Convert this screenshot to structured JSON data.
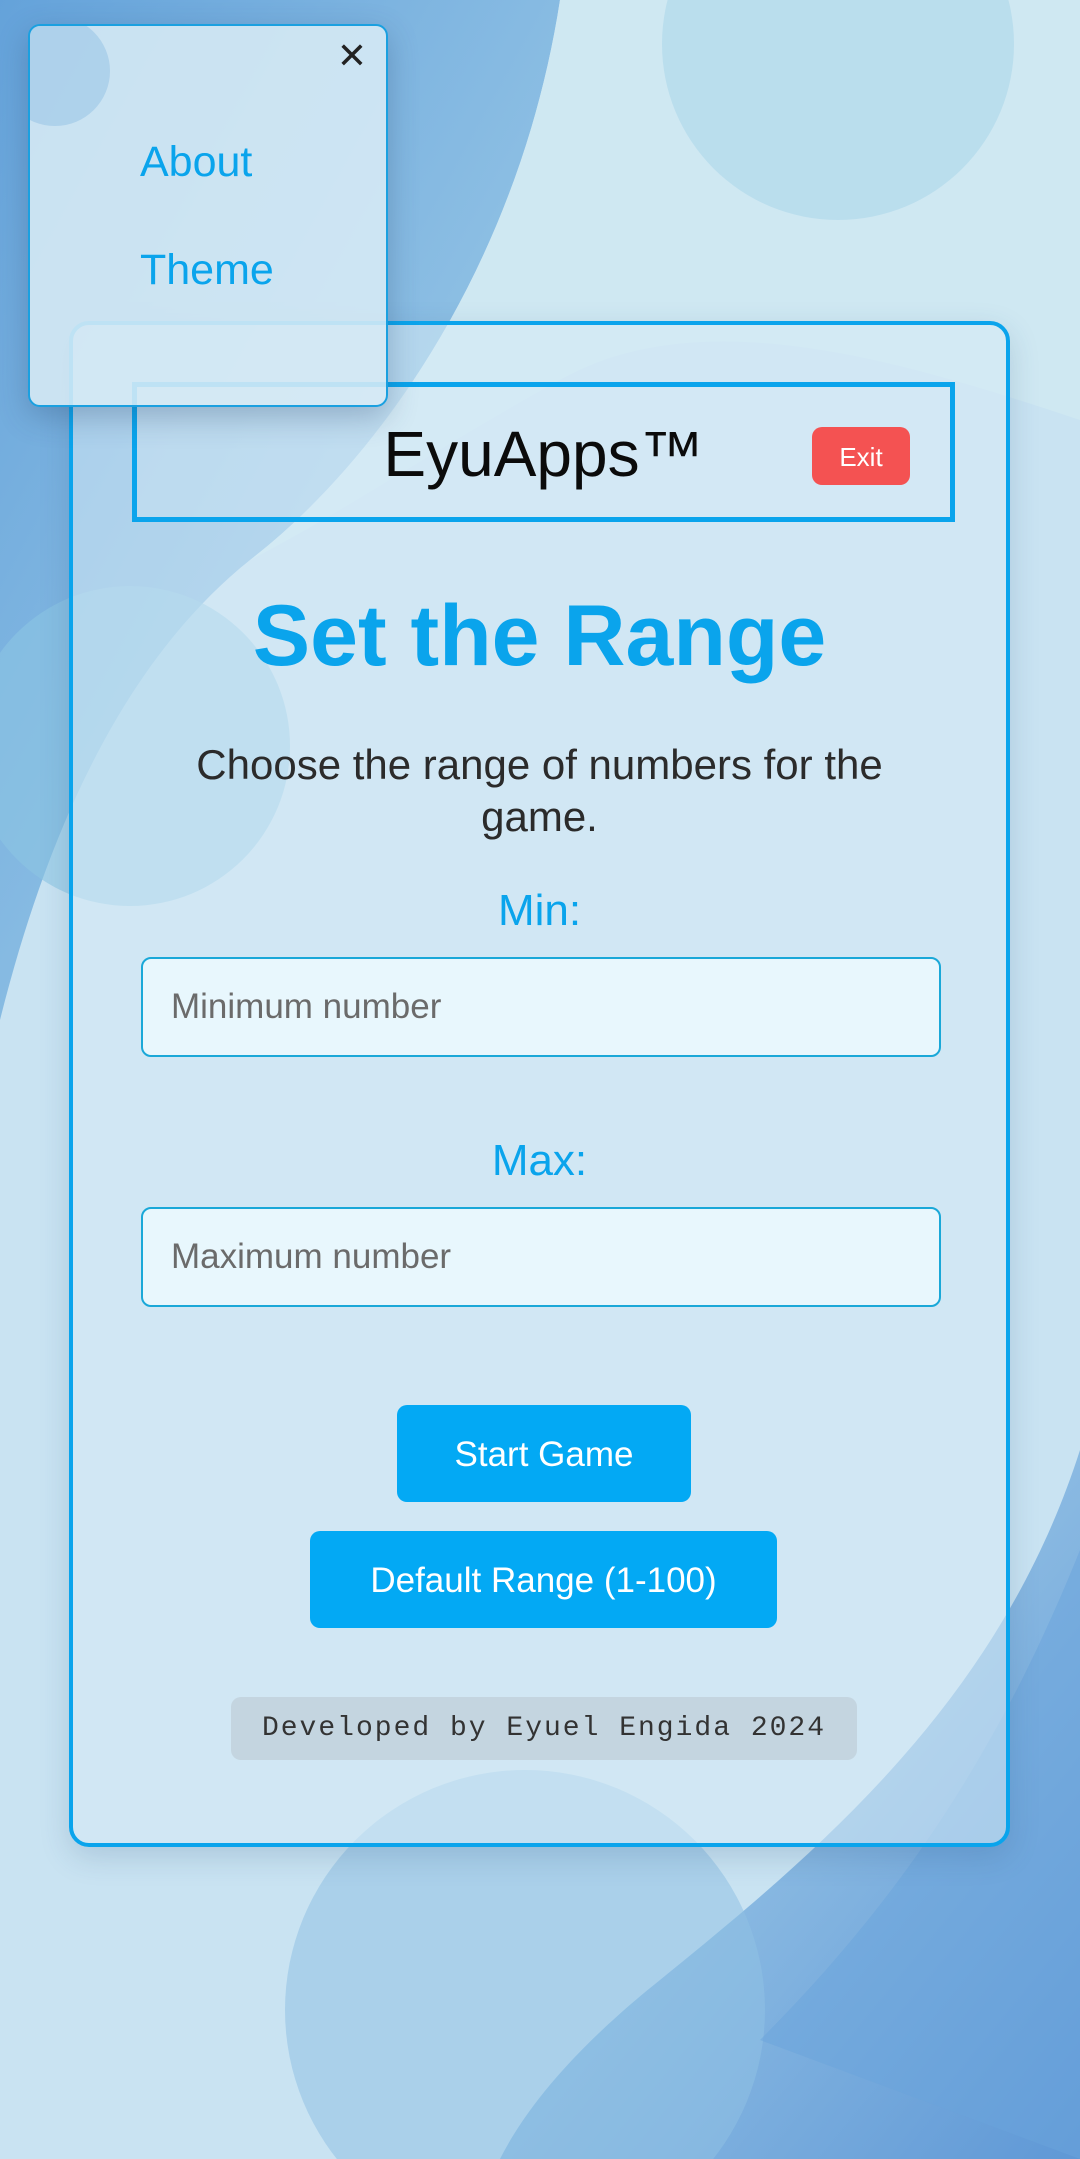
{
  "menu": {
    "close_icon": "close-icon",
    "items": [
      {
        "label": "About"
      },
      {
        "label": "Theme"
      }
    ]
  },
  "header": {
    "brand": "EyuApps™",
    "exit_label": "Exit"
  },
  "main": {
    "title": "Set the Range",
    "subtitle": "Choose the range of numbers for the game.",
    "min_label": "Min:",
    "min_placeholder": "Minimum number",
    "min_value": "",
    "max_label": "Max:",
    "max_placeholder": "Maximum number",
    "max_value": "",
    "start_button": "Start Game",
    "default_button": "Default Range (1-100)"
  },
  "footer": {
    "credit": "Developed by Eyuel Engida 2024"
  },
  "colors": {
    "accent": "#03a9f4",
    "exit": "#f45252",
    "background": "#c7e1f1"
  }
}
